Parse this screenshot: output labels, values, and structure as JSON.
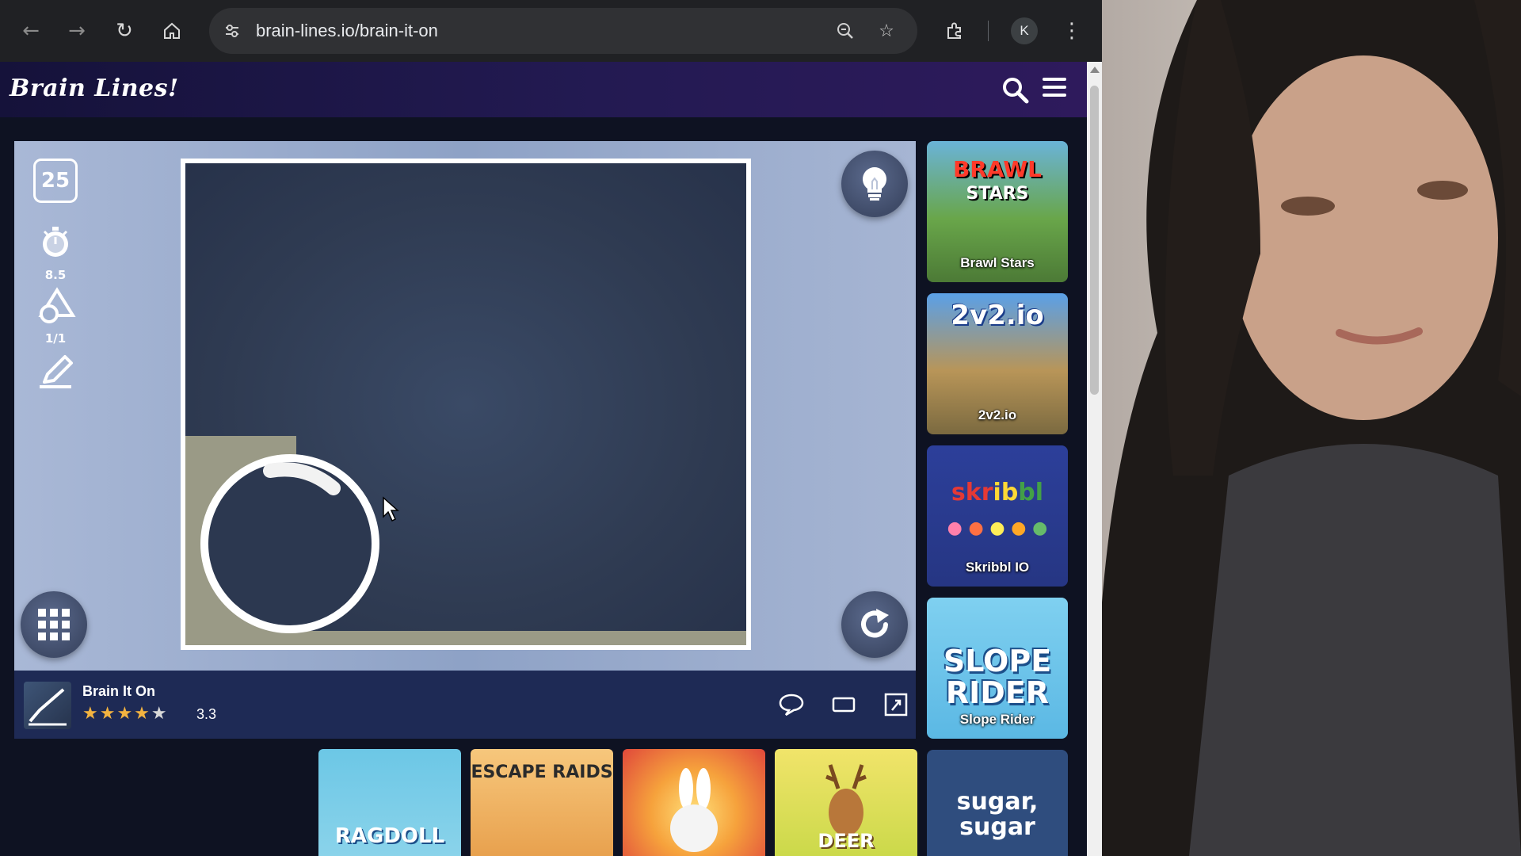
{
  "browser": {
    "url": "brain-lines.io/brain-it-on",
    "profile_initial": "K"
  },
  "site": {
    "logo": "Brain Lines!"
  },
  "game": {
    "level": "25",
    "timer_value": "8.5",
    "shapes_value": "1/1"
  },
  "info": {
    "title": "Brain It On",
    "rating": "3.3",
    "stars_filled": 4
  },
  "side_tiles": [
    {
      "label": "Brawl Stars",
      "art": "BRAWL STARS"
    },
    {
      "label": "2v2.io",
      "art": "2v2.io"
    },
    {
      "label": "Skribbl IO",
      "art": "skribbl"
    },
    {
      "label": "Slope Rider",
      "art": "SLOPE RIDER"
    },
    {
      "label": "",
      "art": "sugar, sugar"
    }
  ],
  "bottom_tiles": [
    {
      "art": "RAGDOLL"
    },
    {
      "art": "ESCAPE RAIDS"
    },
    {
      "art": ""
    },
    {
      "art": "DEER"
    }
  ],
  "colors": {
    "header_start": "#15123a",
    "header_end": "#2e1a5c",
    "infobar": "#1e2a55",
    "star": "#f3b340"
  }
}
